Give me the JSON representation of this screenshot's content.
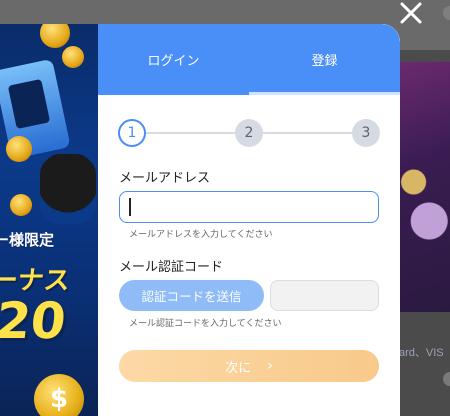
{
  "background": {
    "right_text": "ard、VIS"
  },
  "close": {
    "icon": "close-icon"
  },
  "promo": {
    "line1": "ー様限定",
    "line2": "ーナス",
    "line3": "20",
    "coin_symbol": "$"
  },
  "tabs": {
    "login": "ログイン",
    "register": "登録",
    "active": "register"
  },
  "stepper": {
    "steps": [
      "1",
      "2",
      "3"
    ],
    "current": 1
  },
  "form": {
    "email_label": "メールアドレス",
    "email_value": "",
    "email_hint": "メールアドレスを入力してください",
    "code_label": "メール認証コード",
    "send_code": "認証コードを送信",
    "code_value": "",
    "code_hint": "メール認証コードを入力してください",
    "next": "次に",
    "next_chevron": "›"
  },
  "colors": {
    "accent": "#4a8ff7",
    "next_button": "#f8c98a",
    "send_button": "#8fbcf7"
  }
}
